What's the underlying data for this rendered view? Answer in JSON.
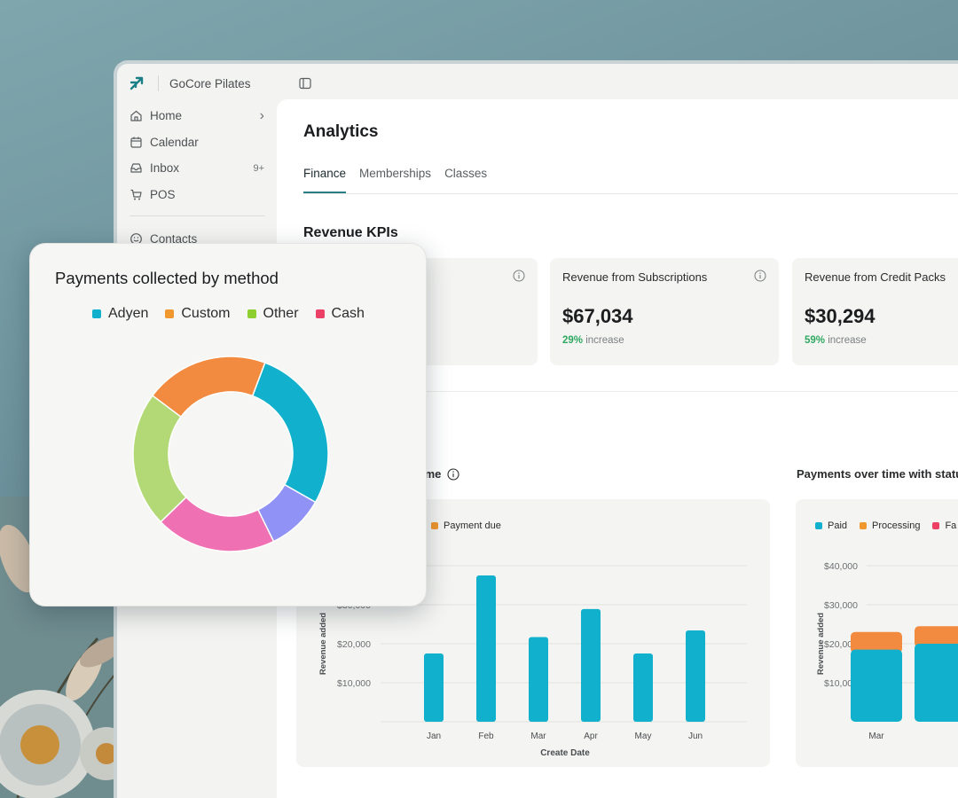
{
  "app": {
    "name": "GoCore Pilates"
  },
  "sidebar": {
    "items": [
      {
        "label": "Home",
        "icon": "home-icon",
        "trail": "›"
      },
      {
        "label": "Calendar",
        "icon": "calendar-icon",
        "trail": ""
      },
      {
        "label": "Inbox",
        "icon": "inbox-icon",
        "trail": "9+"
      },
      {
        "label": "POS",
        "icon": "cart-icon",
        "trail": ""
      }
    ],
    "items2": [
      {
        "label": "Contacts",
        "icon": "smile-icon"
      }
    ]
  },
  "page": {
    "title": "Analytics",
    "tabs": [
      "Finance",
      "Memberships",
      "Classes"
    ],
    "active_tab": "Finance",
    "section_title": "Revenue KPIs"
  },
  "kpis": [
    {
      "title": "Revenue from Subscriptions",
      "value": "$67,034",
      "change": "29%",
      "change_label": "increase"
    },
    {
      "title": "Revenue from Credit Packs",
      "value": "$30,294",
      "change": "59%",
      "change_label": "increase"
    }
  ],
  "colors": {
    "accent": "#2a7f87",
    "increase": "#2fa861",
    "teal": "#11b0cc",
    "orange": "#f28a3f",
    "status_orange": "#f0972e",
    "red": "#ec4067",
    "lavender": "#9093f5",
    "pink": "#f071b3",
    "green": "#b3d977"
  },
  "chart_data": [
    {
      "type": "pie",
      "title": "Payments collected by method",
      "legend": [
        {
          "name": "Adyen",
          "color": "#11b0cc"
        },
        {
          "name": "Custom",
          "color": "#f0972e"
        },
        {
          "name": "Other",
          "color": "#8ccf2f"
        },
        {
          "name": "Cash",
          "color": "#ec4067"
        }
      ],
      "slices": [
        {
          "value": 27.5,
          "color": "#11b0cc"
        },
        {
          "value": 9.5,
          "color": "#9093f5"
        },
        {
          "value": 20,
          "color": "#f071b3"
        },
        {
          "value": 22.5,
          "color": "#b3d977"
        },
        {
          "value": 20.5,
          "color": "#f28a3f"
        }
      ]
    },
    {
      "type": "bar",
      "title": "r time",
      "legend": [
        {
          "name": "Payment due",
          "color": "#f0972e"
        }
      ],
      "categories": [
        "Jan",
        "Feb",
        "Mar",
        "Apr",
        "May",
        "Jun"
      ],
      "values": [
        17500,
        37500,
        21700,
        28900,
        17500,
        23400
      ],
      "xlabel": "Create Date",
      "ylabel": "Revenue added",
      "yticks": [
        "$10,000",
        "$20,000",
        "$30,000"
      ],
      "ylim": [
        0,
        40000
      ]
    },
    {
      "type": "bar",
      "title": "Payments over time with statu",
      "legend": [
        {
          "name": "Paid",
          "color": "#11b0cc"
        },
        {
          "name": "Processing",
          "color": "#f0972e"
        },
        {
          "name": "Fa",
          "color": "#ec4067"
        }
      ],
      "categories": [
        "Mar"
      ],
      "series": [
        {
          "name": "Paid",
          "values": [
            18500,
            20000
          ]
        },
        {
          "name": "Processing",
          "values": [
            4500,
            4500
          ]
        }
      ],
      "ylabel": "Revenue added",
      "yticks": [
        "$10,000",
        "$20,000",
        "$30,000",
        "$40,000"
      ],
      "ylim": [
        0,
        40000
      ]
    }
  ]
}
